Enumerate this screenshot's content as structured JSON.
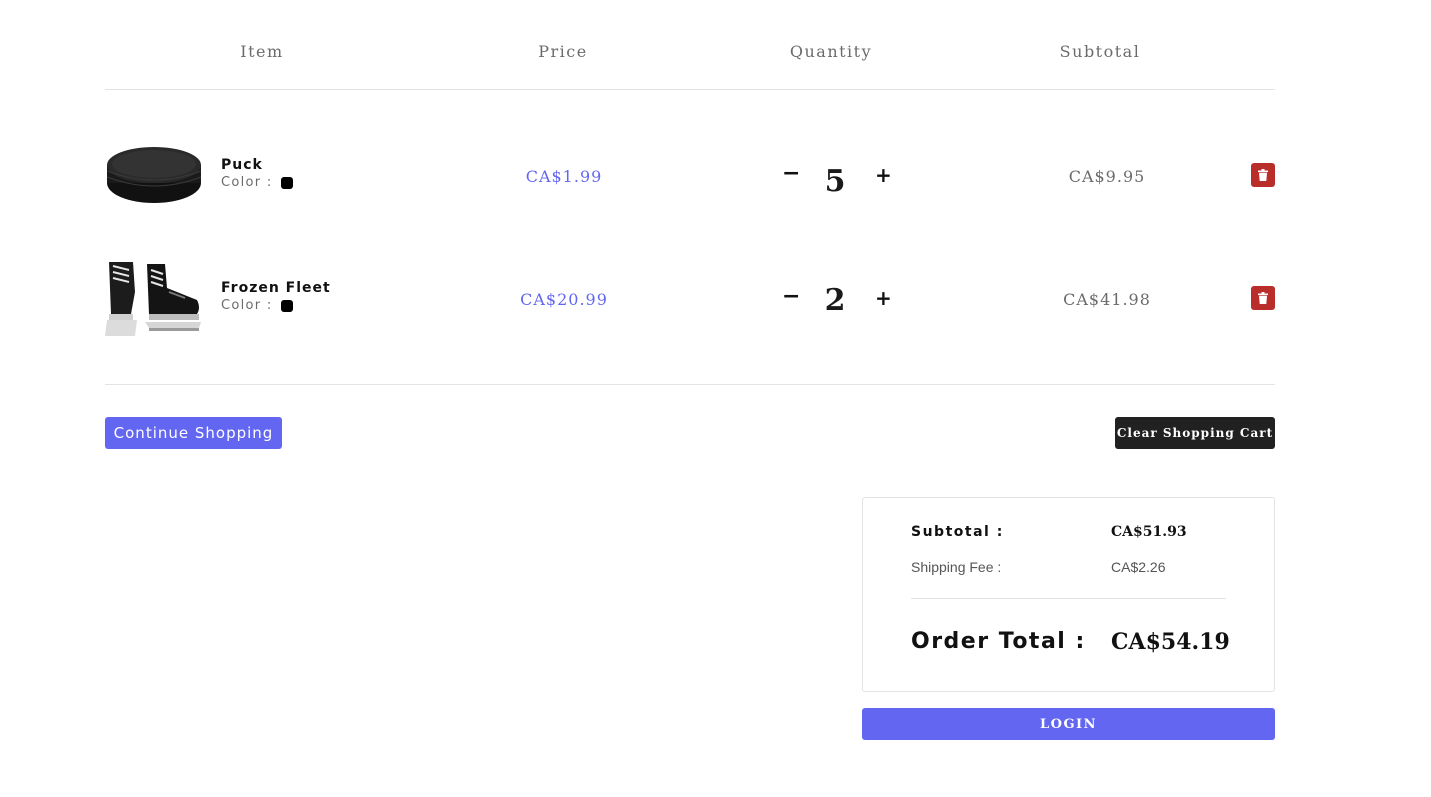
{
  "colors": {
    "accent": "#6366f1",
    "price_text": "#6366f1",
    "muted_text": "#6b6b6b",
    "danger": "#b92d2b",
    "dark_button": "#212121",
    "swatch": "#000000"
  },
  "table": {
    "headers": {
      "item": "Item",
      "price": "Price",
      "quantity": "Quantity",
      "subtotal": "Subtotal"
    },
    "color_label": "Color :",
    "items": [
      {
        "name": "Puck",
        "image": "hockey-puck-image",
        "price": "CA$1.99",
        "quantity": "5",
        "subtotal": "CA$9.95",
        "color": "#000000"
      },
      {
        "name": "Frozen Fleet",
        "image": "hockey-skates-image",
        "price": "CA$20.99",
        "quantity": "2",
        "subtotal": "CA$41.98",
        "color": "#000000"
      }
    ],
    "minus_label": "−",
    "plus_label": "+"
  },
  "actions": {
    "continue_label": "Continue Shopping",
    "clear_label": "Clear Shopping Cart"
  },
  "summary": {
    "subtotal_label": "Subtotal :",
    "subtotal_value": "CA$51.93",
    "shipping_label": "Shipping Fee :",
    "shipping_value": "CA$2.26",
    "total_label": "Order Total :",
    "total_value": "CA$54.19"
  },
  "login_label": "LOGIN"
}
